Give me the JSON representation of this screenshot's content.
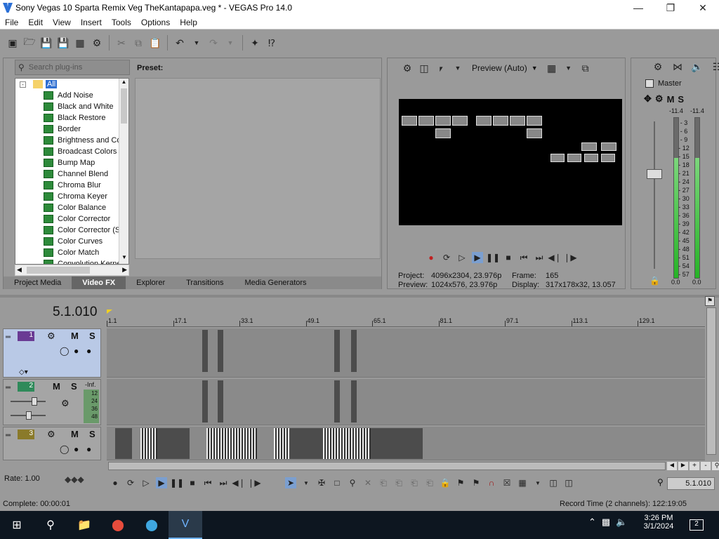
{
  "window": {
    "title": "Sony Vegas 10 Sparta Remix Veg TheKantapapa.veg * - VEGAS Pro 14.0"
  },
  "menu": [
    "File",
    "Edit",
    "View",
    "Insert",
    "Tools",
    "Options",
    "Help"
  ],
  "fx": {
    "search_placeholder": "Search plug-ins",
    "root": "All",
    "items": [
      "Add Noise",
      "Black and White",
      "Black Restore",
      "Border",
      "Brightness and Co",
      "Broadcast Colors",
      "Bump Map",
      "Channel Blend",
      "Chroma Blur",
      "Chroma Keyer",
      "Color Balance",
      "Color Corrector",
      "Color Corrector (S",
      "Color Curves",
      "Color Match",
      "Convolution Kerne"
    ],
    "preset_label": "Preset:",
    "tabs": [
      "Project Media",
      "Video FX",
      "Explorer",
      "Transitions",
      "Media Generators"
    ],
    "active_tab": "Video FX"
  },
  "preview": {
    "mode": "Preview (Auto)",
    "project_label": "Project:",
    "project_value": "4096x2304, 23.976p",
    "preview_label": "Preview:",
    "preview_value": "1024x576, 23.976p",
    "frame_label": "Frame:",
    "frame_value": "165",
    "display_label": "Display:",
    "display_value": "317x178x32, 13.057"
  },
  "master": {
    "label": "Master",
    "left_db": "-11.4",
    "right_db": "-11.4",
    "scale": [
      "3",
      "6",
      "9",
      "12",
      "15",
      "18",
      "21",
      "24",
      "27",
      "30",
      "33",
      "36",
      "39",
      "42",
      "45",
      "48",
      "51",
      "54",
      "57"
    ],
    "left_bottom": "0.0",
    "right_bottom": "0.0"
  },
  "timeline": {
    "time": "5.1.010",
    "ruler": [
      "1.1",
      "17.1",
      "33.1",
      "49.1",
      "65.1",
      "81.1",
      "97.1",
      "113.1",
      "129.1"
    ],
    "tracks": [
      {
        "num": "1",
        "m": "M",
        "s": "S"
      },
      {
        "num": "2",
        "m": "M",
        "s": "S",
        "level": "-Inf.",
        "meter": [
          "12",
          "24",
          "36",
          "48"
        ]
      },
      {
        "num": "3",
        "m": "M",
        "s": "S"
      }
    ],
    "rate": "Rate: 1.00",
    "cursor_time": "5.1.010"
  },
  "status": {
    "complete": "Complete: 00:00:01",
    "record": "Record Time (2 channels): 122:19:05"
  },
  "taskbar": {
    "time": "3:26 PM",
    "date": "3/1/2024",
    "notifications": "2"
  }
}
